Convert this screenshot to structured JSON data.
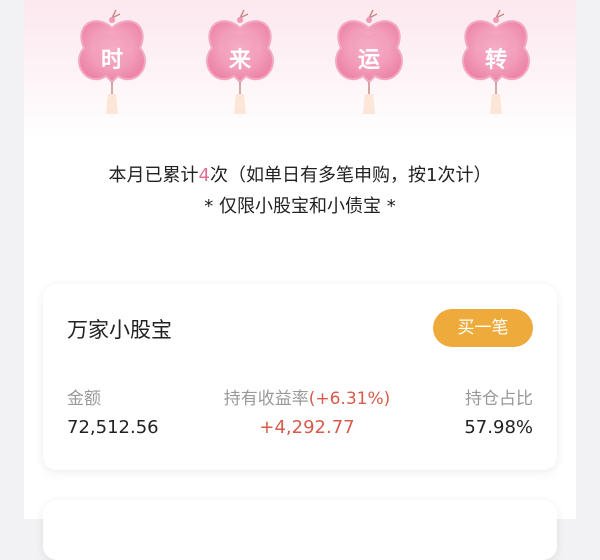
{
  "blossoms": [
    "时",
    "来",
    "运",
    "转"
  ],
  "rules": {
    "line1_prefix": "本月已累计",
    "line1_count": "4",
    "line1_suffix": "次（如单日有多笔申购，按1次计）",
    "line2": "* 仅限小股宝和小债宝 *"
  },
  "fund_card": {
    "name": "万家小股宝",
    "buy_label": "买一笔",
    "amount_label": "金额",
    "amount_value": "72,512.56",
    "yield_label": "持有收益率",
    "yield_pct": "(+6.31%)",
    "yield_value": "+4,292.77",
    "ratio_label": "持仓占比",
    "ratio_value": "57.98%"
  },
  "colors": {
    "accent_pink": "#e26f8f",
    "buy_button": "#eeab3b",
    "positive": "#d75a4a"
  }
}
